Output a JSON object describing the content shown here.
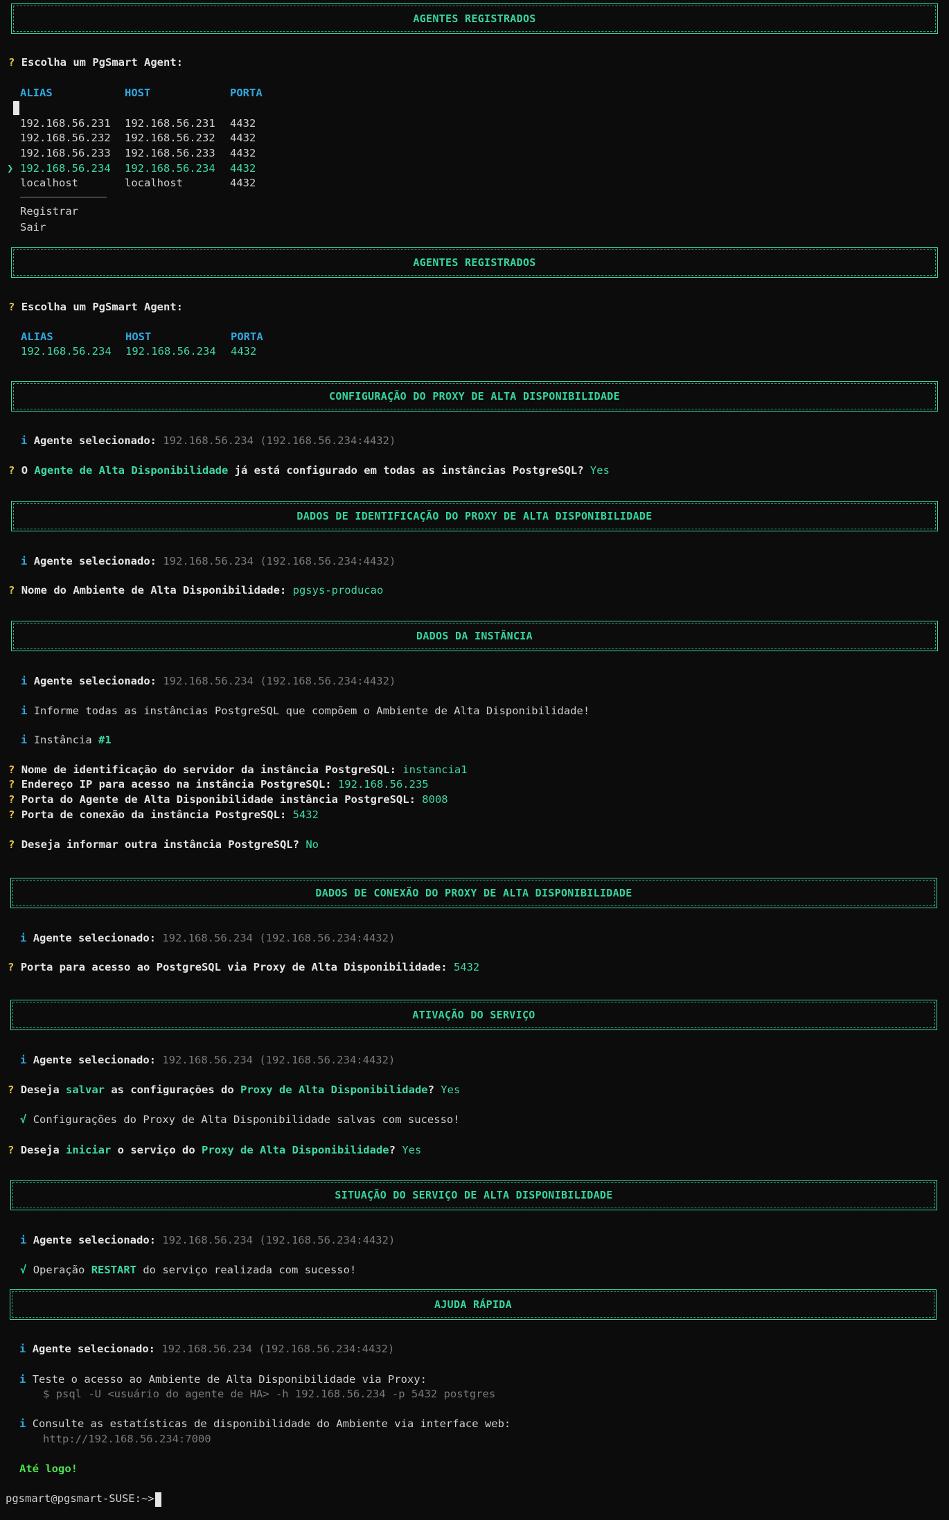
{
  "headers": {
    "agentes": "AGENTES REGISTRADOS",
    "config_proxy": "CONFIGURAÇÃO DO PROXY DE ALTA DISPONIBILIDADE",
    "dados_ident": "DADOS DE IDENTIFICAÇÃO DO PROXY DE ALTA DISPONIBILIDADE",
    "dados_instancia": "DADOS DA INSTÂNCIA",
    "dados_conexao": "DADOS DE CONEXÃO DO PROXY DE ALTA DISPONIBILIDADE",
    "ativacao": "ATIVAÇÃO DO SERVIÇO",
    "situacao": "SITUAÇÃO DO SERVIÇO DE ALTA DISPONIBILIDADE",
    "ajuda": "AJUDA RÁPIDA"
  },
  "symbols": {
    "question": "?",
    "info": "i",
    "check": "√",
    "pointer": "❯"
  },
  "prompt_choose": "Escolha um PgSmart Agent:",
  "table": {
    "columns": [
      "ALIAS",
      "HOST",
      "PORTA"
    ],
    "rows": [
      [
        "192.168.56.231",
        "192.168.56.231",
        "4432"
      ],
      [
        "192.168.56.232",
        "192.168.56.232",
        "4432"
      ],
      [
        "192.168.56.233",
        "192.168.56.233",
        "4432"
      ],
      [
        "192.168.56.234",
        "192.168.56.234",
        "4432"
      ],
      [
        "localhost",
        "localhost",
        "4432"
      ]
    ],
    "separator": "──────────────",
    "extra": [
      "Registrar",
      "Sair"
    ]
  },
  "selected": {
    "alias": "192.168.56.234",
    "host": "192.168.56.234",
    "porta": "4432"
  },
  "agent_label": "Agente selecionado:",
  "agent_value": "192.168.56.234 (192.168.56.234:4432)",
  "config": {
    "q_prefix": "O ",
    "q_highlight": "Agente de Alta Disponibilidade",
    "q_rest": " já está configurado em todas as instâncias PostgreSQL?",
    "answer": "Yes"
  },
  "ident": {
    "q": "Nome do Ambiente de Alta Disponibilidade:",
    "answer": "pgsys-producao"
  },
  "instancia": {
    "info_all": "Informe todas as instâncias PostgreSQL que compõem o Ambiente de Alta Disponibilidade!",
    "label": "Instância",
    "number": "#1",
    "fields": [
      {
        "q": "Nome de identificação do servidor da instância PostgreSQL:",
        "a": "instancia1"
      },
      {
        "q": "Endereço IP para acesso na instância PostgreSQL:",
        "a": "192.168.56.235"
      },
      {
        "q": "Porta do Agente de Alta Disponibilidade instância PostgreSQL:",
        "a": "8008"
      },
      {
        "q": "Porta de conexão da instância PostgreSQL:",
        "a": "5432"
      }
    ],
    "another_q": "Deseja informar outra instância PostgreSQL?",
    "another_a": "No"
  },
  "conexao": {
    "q": "Porta para acesso ao PostgreSQL via Proxy de Alta Disponibilidade:",
    "a": "5432"
  },
  "ativacao": {
    "q1_a": "Deseja ",
    "q1_b": "salvar",
    "q1_c": " as configurações do ",
    "q1_d": "Proxy de Alta Disponibilidade",
    "q1_e": "?",
    "a1": "Yes",
    "success": "Configurações do Proxy de Alta Disponibilidade salvas com sucesso!",
    "q2_a": "Deseja ",
    "q2_b": "iniciar",
    "q2_c": " o serviço do ",
    "q2_d": "Proxy de Alta Disponibilidade",
    "q2_e": "?",
    "a2": "Yes"
  },
  "situacao": {
    "pre": "Operação ",
    "op": "RESTART",
    "post": " do serviço realizada com sucesso!"
  },
  "ajuda": {
    "test_info": "Teste o acesso ao Ambiente de Alta Disponibilidade via Proxy:",
    "test_cmd": "$ psql -U <usuário do agente de HA> -h 192.168.56.234 -p 5432 postgres",
    "stats_info": "Consulte as estatísticas de disponibilidade do Ambiente via interface web:",
    "stats_url": "http://192.168.56.234:7000",
    "bye": "Até logo!"
  },
  "shell_prompt": "pgsmart@pgsmart-SUSE:~> "
}
